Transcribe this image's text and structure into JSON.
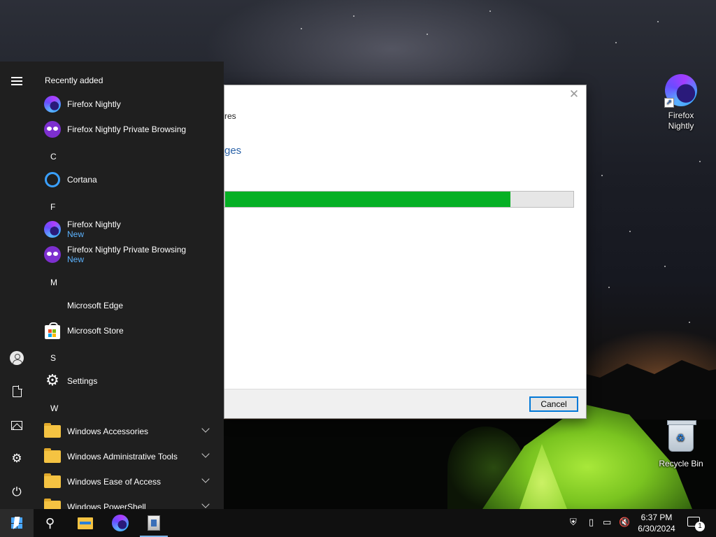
{
  "desktop": {
    "icons": [
      {
        "label_line1": "Firefox",
        "label_line2": "Nightly",
        "icon": "firefox-nightly-icon"
      },
      {
        "label_line1": "Recycle Bin",
        "label_line2": "",
        "icon": "recycle-bin-icon"
      }
    ]
  },
  "dialog": {
    "close_glyph": "✕",
    "line_text": "res",
    "heading_text": "ges",
    "progress_fraction": 0.82,
    "progress_color": "#06b025",
    "cancel_label": "Cancel"
  },
  "start_menu": {
    "recently_added_label": "Recently added",
    "recent_items": [
      {
        "label": "Firefox Nightly",
        "icon": "firefox-nightly-icon"
      },
      {
        "label": "Firefox Nightly Private Browsing",
        "icon": "firefox-private-icon"
      }
    ],
    "groups": [
      {
        "letter": "C",
        "items": [
          {
            "label": "Cortana",
            "icon": "cortana-icon"
          }
        ]
      },
      {
        "letter": "F",
        "items": [
          {
            "label": "Firefox Nightly",
            "badge": "New",
            "icon": "firefox-nightly-icon"
          },
          {
            "label": "Firefox Nightly Private Browsing",
            "badge": "New",
            "icon": "firefox-private-icon"
          }
        ]
      },
      {
        "letter": "M",
        "items": [
          {
            "label": "Microsoft Edge",
            "icon": "edge-icon"
          },
          {
            "label": "Microsoft Store",
            "icon": "store-icon"
          }
        ]
      },
      {
        "letter": "S",
        "items": [
          {
            "label": "Settings",
            "icon": "settings-icon"
          }
        ]
      },
      {
        "letter": "W",
        "items": [
          {
            "label": "Windows Accessories",
            "icon": "folder-icon",
            "expandable": true
          },
          {
            "label": "Windows Administrative Tools",
            "icon": "folder-icon",
            "expandable": true
          },
          {
            "label": "Windows Ease of Access",
            "icon": "folder-icon",
            "expandable": true
          },
          {
            "label": "Windows PowerShell",
            "icon": "folder-icon",
            "expandable": true
          }
        ]
      }
    ],
    "rail_icons": [
      "hamburger-menu-icon",
      "user-account-icon",
      "documents-icon",
      "pictures-icon",
      "settings-icon",
      "power-icon"
    ]
  },
  "taskbar": {
    "pinned": [
      "start-icon",
      "search-icon",
      "file-explorer-icon",
      "firefox-nightly-icon",
      "installer-icon"
    ],
    "tray_icons": [
      "windows-security-icon",
      "usb-device-icon",
      "network-icon",
      "volume-muted-icon"
    ],
    "time": "6:37 PM",
    "date": "6/30/2024",
    "notification_count": "1"
  },
  "colors": {
    "start_bg": "#1f1f1f",
    "accent_new": "#5cb3ff",
    "taskbar_bg": "#101010",
    "progress_fill": "#06b025"
  }
}
